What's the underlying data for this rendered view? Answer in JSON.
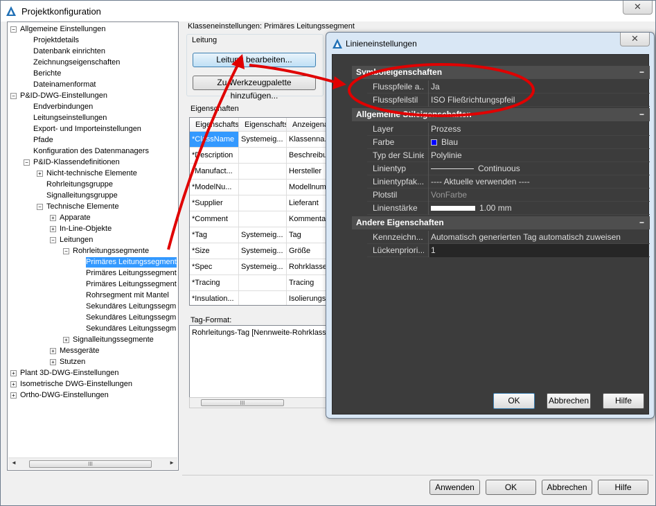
{
  "window": {
    "title": "Projektkonfiguration",
    "close": "✕"
  },
  "tree": [
    {
      "label": "Allgemeine Einstellungen",
      "level": 0,
      "toggle": "−"
    },
    {
      "label": "Projektdetails",
      "level": 1
    },
    {
      "label": "Datenbank einrichten",
      "level": 1
    },
    {
      "label": "Zeichnungseigenschaften",
      "level": 1
    },
    {
      "label": "Berichte",
      "level": 1
    },
    {
      "label": "Dateinamenformat",
      "level": 1
    },
    {
      "label": "P&ID-DWG-Einstellungen",
      "level": 0,
      "toggle": "−"
    },
    {
      "label": "Endverbindungen",
      "level": 1
    },
    {
      "label": "Leitungseinstellungen",
      "level": 1
    },
    {
      "label": "Export- und Importeinstellungen",
      "level": 1
    },
    {
      "label": "Pfade",
      "level": 1
    },
    {
      "label": "Konfiguration des Datenmanagers",
      "level": 1
    },
    {
      "label": "P&ID-Klassendefinitionen",
      "level": 1,
      "toggle": "−"
    },
    {
      "label": "Nicht-technische Elemente",
      "level": 2,
      "toggle": "+"
    },
    {
      "label": "Rohrleitungsgruppe",
      "level": 2
    },
    {
      "label": "Signalleitungsgruppe",
      "level": 2
    },
    {
      "label": "Technische Elemente",
      "level": 2,
      "toggle": "−"
    },
    {
      "label": "Apparate",
      "level": 3,
      "toggle": "+"
    },
    {
      "label": "In-Line-Objekte",
      "level": 3,
      "toggle": "+"
    },
    {
      "label": "Leitungen",
      "level": 3,
      "toggle": "−"
    },
    {
      "label": "Rohrleitungssegmente",
      "level": 4,
      "toggle": "−"
    },
    {
      "label": "Primäres Leitungssegment",
      "level": 5,
      "selected": true
    },
    {
      "label": "Primäres Leitungssegment",
      "level": 5
    },
    {
      "label": "Primäres Leitungssegment",
      "level": 5
    },
    {
      "label": "Rohrsegment mit Mantel",
      "level": 5
    },
    {
      "label": "Sekundäres Leitungssegm",
      "level": 5
    },
    {
      "label": "Sekundäres Leitungssegm",
      "level": 5
    },
    {
      "label": "Sekundäres Leitungssegm",
      "level": 5
    },
    {
      "label": "Signalleitungssegmente",
      "level": 4,
      "toggle": "+"
    },
    {
      "label": "Messgeräte",
      "level": 3,
      "toggle": "+"
    },
    {
      "label": "Stutzen",
      "level": 3,
      "toggle": "+"
    },
    {
      "label": "Plant 3D-DWG-Einstellungen",
      "level": 0,
      "toggle": "+"
    },
    {
      "label": "Isometrische DWG-Einstellungen",
      "level": 0,
      "toggle": "+"
    },
    {
      "label": "Ortho-DWG-Einstellungen",
      "level": 0,
      "toggle": "+"
    }
  ],
  "tree_scroll": {
    "thumb": "III",
    "left": "◄",
    "right": "►"
  },
  "right": {
    "header": "Klasseneinstellungen: Primäres Leitungssegment",
    "group_leitung": "Leitung",
    "btn_edit": "Leitung bearbeiten...",
    "btn_palette": "Zu Werkzeugpalette hinzufügen...",
    "group_props": "Eigenschaften",
    "grid_headers": [
      "Eigenschafts",
      "Eigenschafts",
      "Anzeigena"
    ],
    "grid_rows": [
      [
        "*ClassName",
        "Systemeig...",
        "Klassenna..."
      ],
      [
        "*Description",
        "",
        "Beschreibu"
      ],
      [
        "*Manufact...",
        "",
        "Hersteller"
      ],
      [
        "*ModelNu...",
        "",
        "Modellnum..."
      ],
      [
        "*Supplier",
        "",
        "Lieferant"
      ],
      [
        "*Comment",
        "",
        "Kommentar"
      ],
      [
        "*Tag",
        "Systemeig...",
        "Tag"
      ],
      [
        "*Size",
        "Systemeig...",
        "Größe"
      ],
      [
        "*Spec",
        "Systemeig...",
        "Rohrklasse"
      ],
      [
        "*Tracing",
        "",
        "Tracing"
      ],
      [
        "*Insulation...",
        "",
        "Isolierungst"
      ]
    ],
    "tag_format_label": "Tag-Format:",
    "tag_format_value": "Rohrleitungs-Tag [Nennweite-Rohrklasse-",
    "grid_scroll": "III"
  },
  "bottom_buttons": [
    "Anwenden",
    "OK",
    "Abbrechen",
    "Hilfe"
  ],
  "dialog": {
    "title": "Linieneinstellungen",
    "close": "✕",
    "sections": [
      {
        "title": "Symboleigenschaften",
        "rows": [
          {
            "key": "Flusspfeile a...",
            "value": "Ja"
          },
          {
            "key": "Flusspfeilstil",
            "value": "ISO Fließrichtungspfeil"
          }
        ]
      },
      {
        "title": "Allgemeine Stileigenschaften",
        "rows": [
          {
            "key": "Layer",
            "value": "Prozess"
          },
          {
            "key": "Farbe",
            "value": "Blau"
          },
          {
            "key": "Typ der SLinie",
            "value": "Polylinie"
          },
          {
            "key": "Linientyp",
            "value": "Continuous"
          },
          {
            "key": "Linientypfak...",
            "value": "---- Aktuelle verwenden ----"
          },
          {
            "key": "Plotstil",
            "value": "VonFarbe"
          },
          {
            "key": "Linienstärke",
            "value": "1.00 mm"
          }
        ]
      },
      {
        "title": "Andere Eigenschaften",
        "rows": [
          {
            "key": "Kennzeichn...",
            "value": "Automatisch generierten Tag automatisch zuweisen"
          },
          {
            "key": "Lückenpriori...",
            "value": "1"
          }
        ]
      }
    ],
    "collapse": "−",
    "buttons": [
      "OK",
      "Abbrechen",
      "Hilfe"
    ],
    "color_blue": "#0000ff",
    "annotation_color": "#e00000"
  }
}
